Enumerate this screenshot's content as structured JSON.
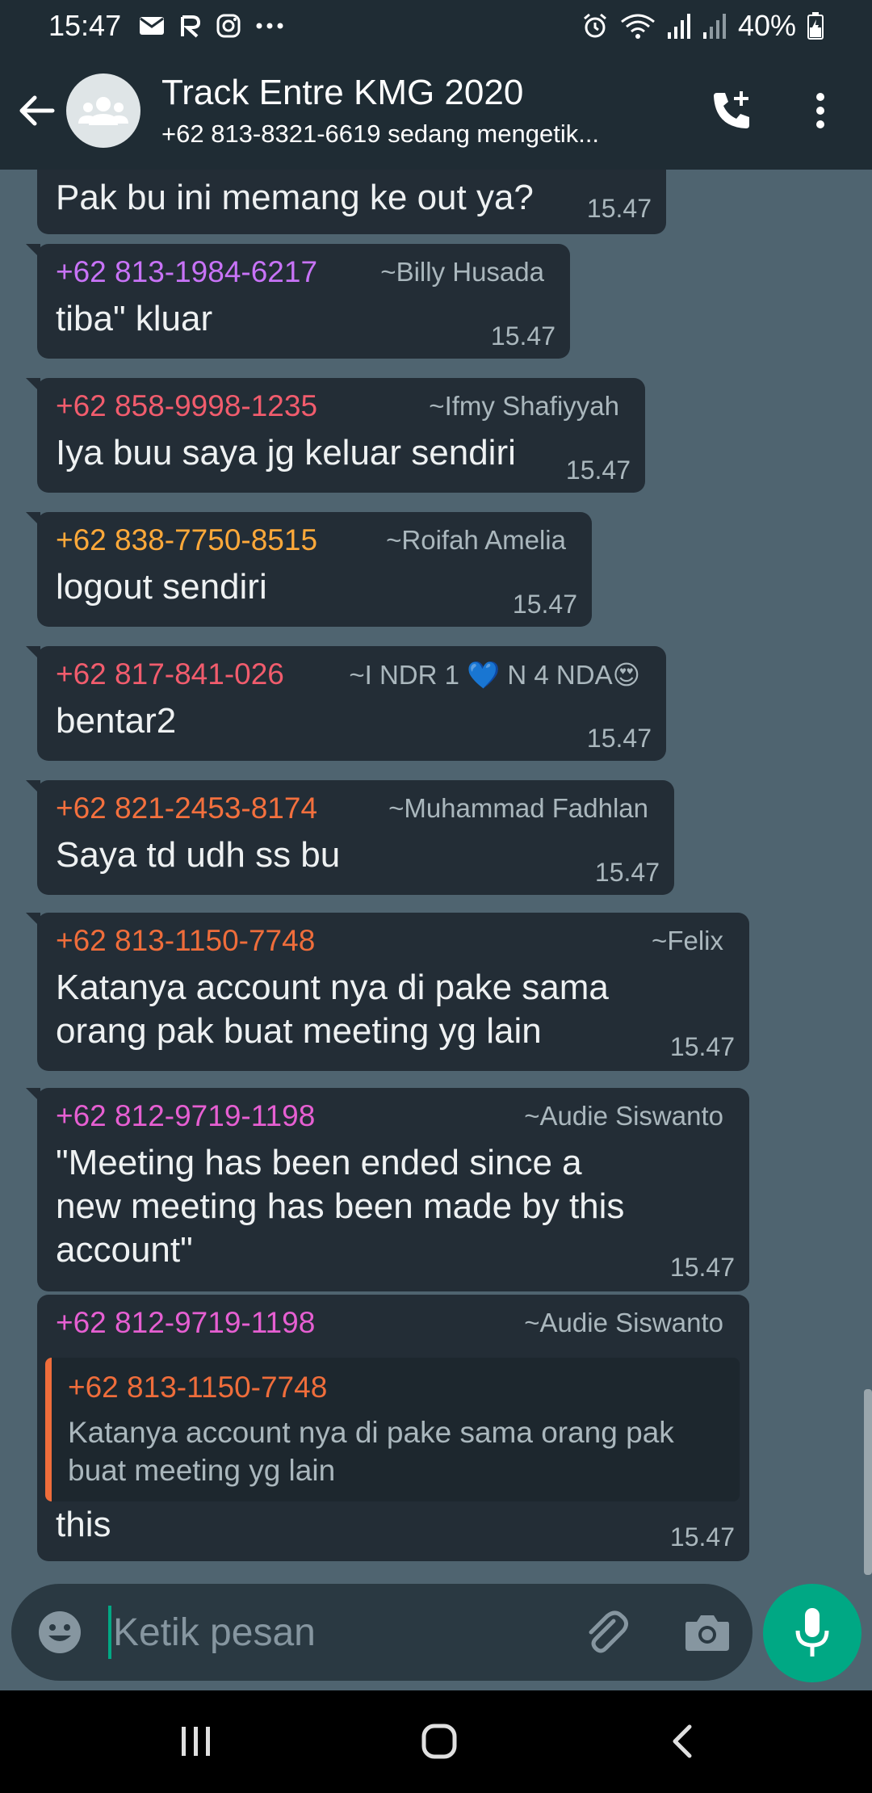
{
  "status_bar": {
    "time": "15:47",
    "battery": "40%",
    "icons": [
      "mail-icon",
      "app-icon",
      "instagram-icon",
      "more-dots-icon",
      "alarm-icon",
      "wifi-icon",
      "signal-icon",
      "signal-icon",
      "battery-icon"
    ]
  },
  "header": {
    "title": "Track Entre KMG 2020",
    "subtitle": "+62 813-8321-6619 sedang mengetik...",
    "icons": [
      "back-arrow-icon",
      "group-avatar-icon",
      "add-call-icon",
      "more-vertical-icon"
    ]
  },
  "messages": [
    {
      "sender": "",
      "alias": "",
      "text": "Pak bu ini memang ke out ya?",
      "time": "15.47"
    },
    {
      "sender": "+62 813-1984-6217",
      "alias": "~Billy Husada",
      "text": "tiba\" kluar",
      "time": "15.47",
      "color": "#c873f7"
    },
    {
      "sender": "+62 858-9998-1235",
      "alias": "~Ifmy Shafiyyah",
      "text": "Iya buu saya jg keluar sendiri",
      "time": "15.47",
      "color": "#f15c6d"
    },
    {
      "sender": "+62 838-7750-8515",
      "alias": "~Roifah Amelia",
      "text": "logout sendiri",
      "time": "15.47",
      "color": "#ffa93a"
    },
    {
      "sender": "+62 817-841-026",
      "alias": "~I NDR 1 💙 N 4 NDA😍",
      "text": "bentar2",
      "time": "15.47",
      "color": "#f15c6d"
    },
    {
      "sender": "+62 821-2453-8174",
      "alias": "~Muhammad Fadhlan",
      "text": "Saya td udh ss bu",
      "time": "15.47",
      "color": "#f4703e"
    },
    {
      "sender": "+62 813-1150-7748",
      "alias": "~Felix",
      "text_lines": [
        "Katanya account nya di pake sama",
        "orang pak buat meeting yg lain"
      ],
      "time": "15.47",
      "color": "#ef6d3b"
    },
    {
      "sender": "+62 812-9719-1198",
      "alias": "~Audie Siswanto",
      "text_lines": [
        "\"Meeting has been ended since a",
        "new meeting has been made by this",
        "account\""
      ],
      "time": "15.47",
      "color": "#e65fd2"
    },
    {
      "sender": "+62 812-9719-1198",
      "alias": "~Audie Siswanto",
      "quote": {
        "sender": "+62 813-1150-7748",
        "lines": [
          "Katanya account nya di pake sama orang pak",
          "buat meeting yg lain"
        ]
      },
      "text": "this",
      "time": "15.47",
      "color": "#e65fd2"
    }
  ],
  "composer": {
    "placeholder": "Ketik pesan",
    "icons": [
      "emoji-icon",
      "attach-icon",
      "camera-icon",
      "mic-icon"
    ]
  },
  "nav": {
    "icons": [
      "recent-apps-icon",
      "home-icon",
      "back-icon"
    ]
  }
}
